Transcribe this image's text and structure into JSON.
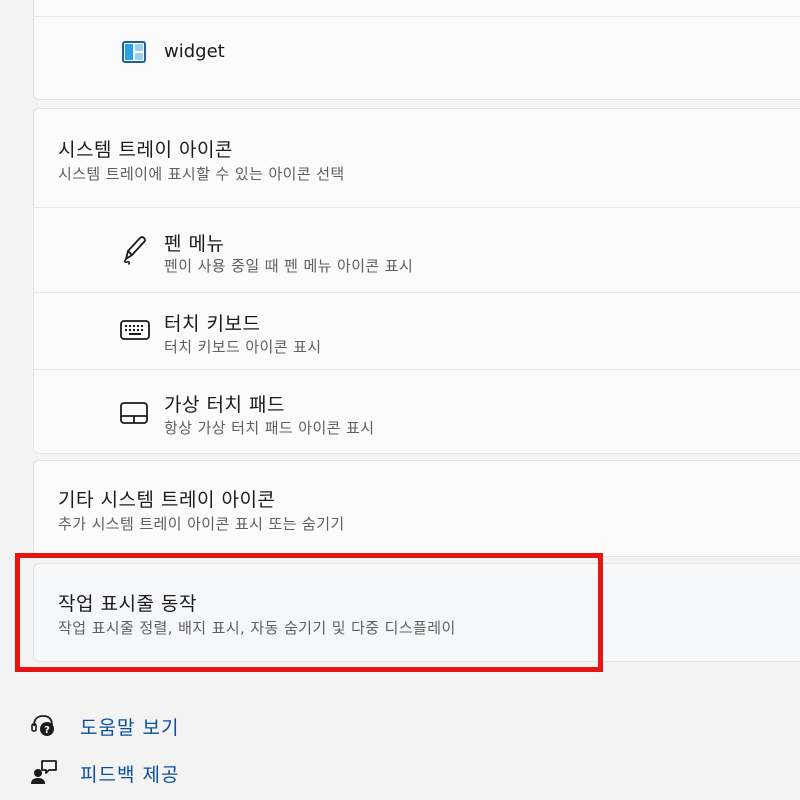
{
  "widget_row": {
    "label": "widget",
    "icon": "widget-icon"
  },
  "system_tray": {
    "title": "시스템 트레이 아이콘",
    "subtitle": "시스템 트레이에 표시할 수 있는 아이콘 선택",
    "items": [
      {
        "title": "펜 메뉴",
        "subtitle": "펜이 사용 중일 때 펜 메뉴 아이콘 표시",
        "icon": "pen-icon"
      },
      {
        "title": "터치 키보드",
        "subtitle": "터치 키보드 아이콘 표시",
        "icon": "keyboard-icon"
      },
      {
        "title": "가상 터치 패드",
        "subtitle": "항상 가상 터치 패드 아이콘 표시",
        "icon": "touchpad-icon"
      }
    ]
  },
  "other_tray": {
    "title": "기타 시스템 트레이 아이콘",
    "subtitle": "추가 시스템 트레이 아이콘 표시 또는 숨기기"
  },
  "taskbar_behavior": {
    "title": "작업 표시줄 동작",
    "subtitle": "작업 표시줄 정렬, 배지 표시, 자동 숨기기 및 다중 디스플레이"
  },
  "footer": {
    "help": {
      "label": "도움말 보기",
      "icon": "help-icon"
    },
    "feedback": {
      "label": "피드백 제공",
      "icon": "feedback-icon"
    }
  },
  "colors": {
    "accent_link": "#0a4f9e",
    "highlight_border": "#e81313"
  }
}
